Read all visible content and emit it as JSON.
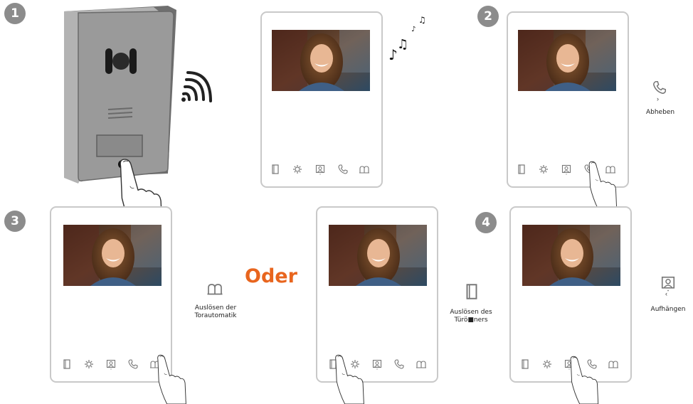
{
  "steps": {
    "s1": "1",
    "s2": "2",
    "s3": "3",
    "s4": "4"
  },
  "captions": {
    "pickup": "Abheben",
    "gate_line1": "Auslösen der",
    "gate_line2": "Torautomatik",
    "oder": "Oder",
    "door_line1": "Auslösen des",
    "door_line2": "Türö■ners",
    "hangup": "Aufhängen"
  },
  "icons": [
    "door-icon",
    "settings-icon",
    "intercom-icon",
    "phone-icon",
    "gate-icon",
    "music-notes-icon",
    "wifi-signal-icon",
    "finger-icon"
  ],
  "colors": {
    "accent": "#e8651e",
    "step_badge": "#8c8c8c",
    "frame": "#c9c9c9",
    "panel": "#9a9a9a"
  }
}
